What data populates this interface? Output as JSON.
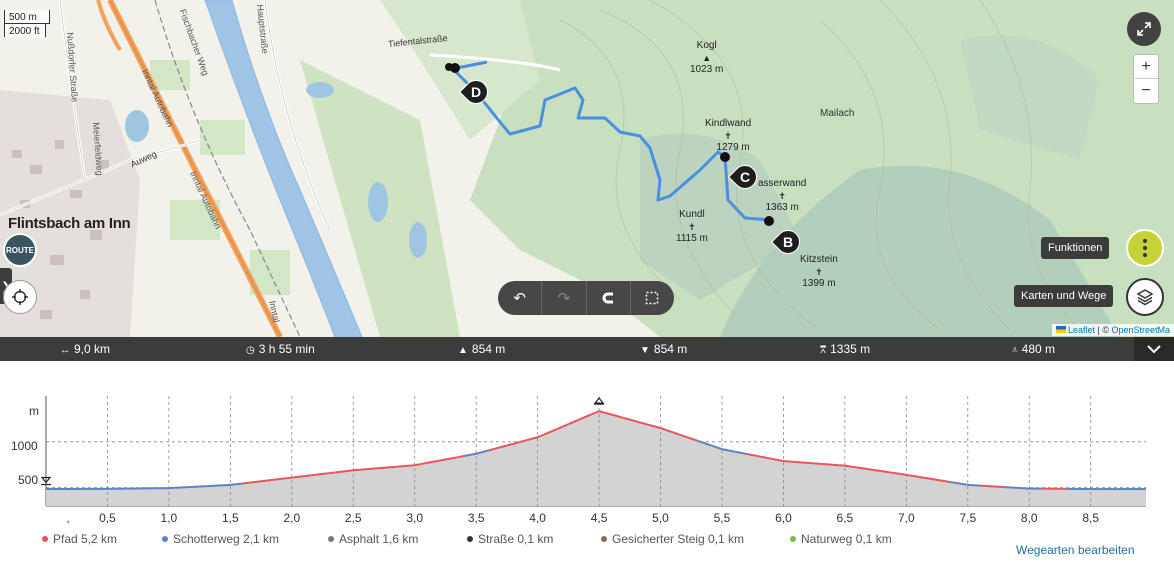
{
  "map": {
    "scale_metric": "500 m",
    "scale_imperial": "2000 ft",
    "town": "Flintsbach am Inn",
    "streets": {
      "tiefental": "Tiefentalstraße",
      "nussdorfer": "Nußdorfer Straße",
      "meierfeldweg": "Meierfeldweg",
      "auweg": "Auweg",
      "inntal1": "Inntal Autobahn",
      "inntal2": "Inntal Autobahn",
      "inntal3": "Inntal",
      "fischbacher": "Fischbacher Weg",
      "hauptstrasse": "Hauptstraße",
      "mailach": "Mailach"
    },
    "peaks": [
      {
        "name": "Kogl",
        "elev": "1023 m"
      },
      {
        "name": "Kindlwand",
        "elev": "1279 m"
      },
      {
        "name": "asserwand",
        "elev": "1363 m"
      },
      {
        "name": "Kundl",
        "elev": "1115 m"
      },
      {
        "name": "Kitzstein",
        "elev": "1399 m"
      }
    ],
    "waypoints": [
      "B",
      "C",
      "D"
    ],
    "attribution": {
      "leaflet": "Leaflet",
      "sep": " | © ",
      "osm": "OpenStreetMa"
    },
    "functions_label": "Funktionen",
    "layers_label": "Karten und Wege",
    "logo_text": "ROUTE",
    "zoom_in": "+",
    "zoom_out": "−",
    "edit_tools": {
      "undo": "↶",
      "redo": "↷",
      "magnet": "⊂",
      "select": "⬚"
    }
  },
  "stats": {
    "distance": "9,0 km",
    "duration": "3 h 55 min",
    "ascent": "854 m",
    "descent": "854 m",
    "highest": "1335 m",
    "lowest": "480 m"
  },
  "profile": {
    "y_unit": "m",
    "y_ticks": [
      "1000",
      "500"
    ],
    "x_ticks": [
      ",",
      "0,5",
      "1,0",
      "1,5",
      "2,0",
      "2,5",
      "3,0",
      "3,5",
      "4,0",
      "4,5",
      "5,0",
      "5,5",
      "6,0",
      "6,5",
      "7,0",
      "7,5",
      "8,0",
      "8,5"
    ],
    "legend": [
      {
        "label": "Pfad 5,2 km",
        "color": "#e8545b"
      },
      {
        "label": "Schotterweg 2,1 km",
        "color": "#5b82c8"
      },
      {
        "label": "Asphalt 1,6 km",
        "color": "#777777"
      },
      {
        "label": "Straße 0,1 km",
        "color": "#333333"
      },
      {
        "label": "Gesicherter Steig 0,1 km",
        "color": "#8a6a5a"
      },
      {
        "label": "Naturweg 0,1 km",
        "color": "#6cbf4a"
      }
    ],
    "edit_link": "Wegearten bearbeiten"
  },
  "chart_data": {
    "type": "area",
    "title": "",
    "xlabel": "",
    "ylabel": "m",
    "x": [
      0,
      0.5,
      1.0,
      1.5,
      2.0,
      2.5,
      3.0,
      3.5,
      4.0,
      4.5,
      5.0,
      5.5,
      6.0,
      6.5,
      7.0,
      7.5,
      8.0,
      8.5,
      8.95
    ],
    "series": [
      {
        "values": [
          485,
          487,
          495,
          530,
          610,
          690,
          745,
          870,
          1050,
          1335,
          1150,
          920,
          790,
          740,
          640,
          530,
          490,
          485,
          485
        ]
      }
    ],
    "xlim": [
      0,
      8.95
    ],
    "ylim": [
      300,
      1500
    ],
    "max_marker": 1335,
    "min_marker": 480
  }
}
